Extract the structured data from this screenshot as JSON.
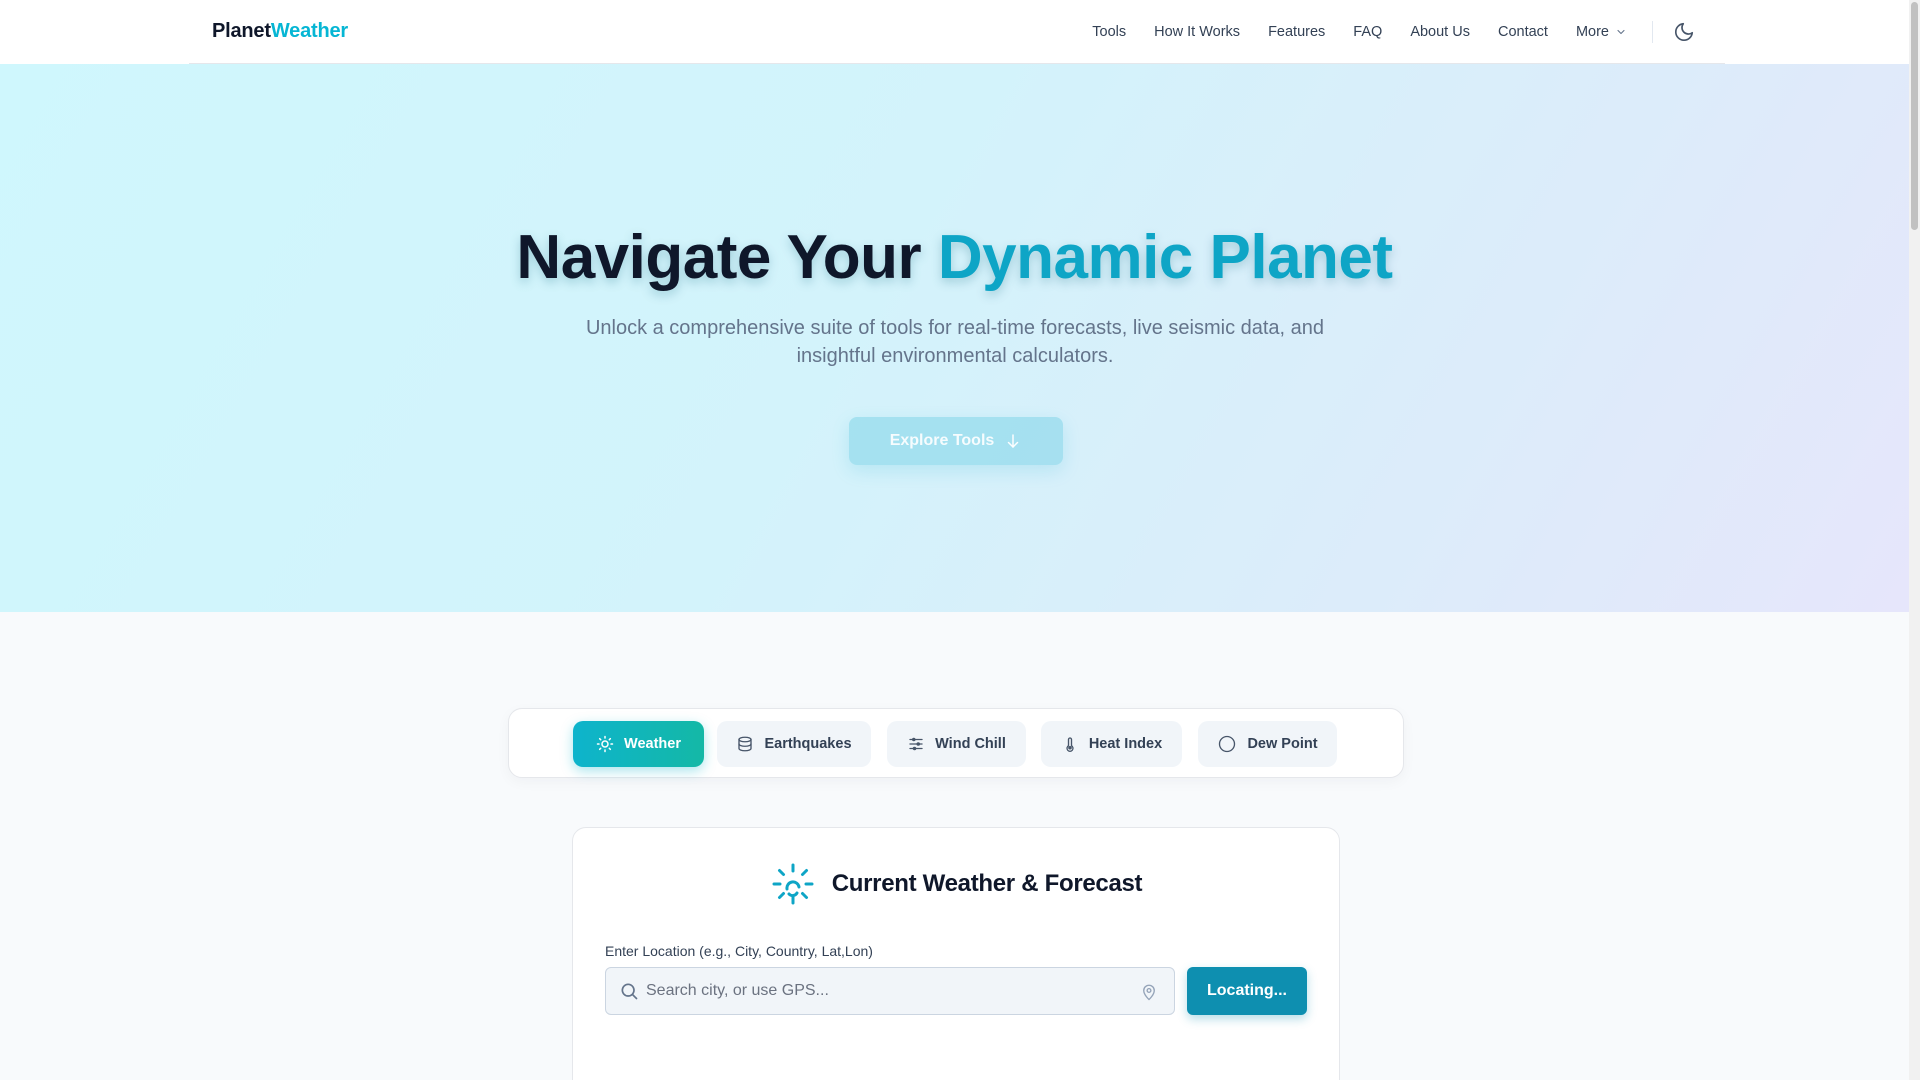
{
  "brand": {
    "part1": "Planet",
    "part2": "Weather"
  },
  "nav": {
    "items": [
      "Tools",
      "How It Works",
      "Features",
      "FAQ",
      "About Us",
      "Contact"
    ],
    "more_label": "More"
  },
  "hero": {
    "title_part1": "Navigate Your ",
    "title_accent": "Dynamic Planet",
    "subtitle": "Unlock a comprehensive suite of tools for real-time forecasts, live seismic data, and insightful environmental calculators.",
    "button_label": "Explore Tools"
  },
  "tabs": [
    {
      "label": "Weather",
      "icon": "sun-icon",
      "active": true
    },
    {
      "label": "Earthquakes",
      "icon": "layers-icon",
      "active": false
    },
    {
      "label": "Wind Chill",
      "icon": "sliders-icon",
      "active": false
    },
    {
      "label": "Heat Index",
      "icon": "thermometer-icon",
      "active": false
    },
    {
      "label": "Dew Point",
      "icon": "circle-icon",
      "active": false
    }
  ],
  "weather_card": {
    "title": "Current Weather & Forecast",
    "icon": "sun-spinner-icon",
    "location_label": "Enter Location (e.g., City, Country, Lat,Lon)",
    "search_placeholder": "Search city, or use GPS...",
    "search_value": "",
    "locate_button": "Locating..."
  },
  "colors": {
    "brand_accent": "#06b6d4",
    "tab_active": "#0eb4cc",
    "locate_button": "#0e8fb0"
  }
}
